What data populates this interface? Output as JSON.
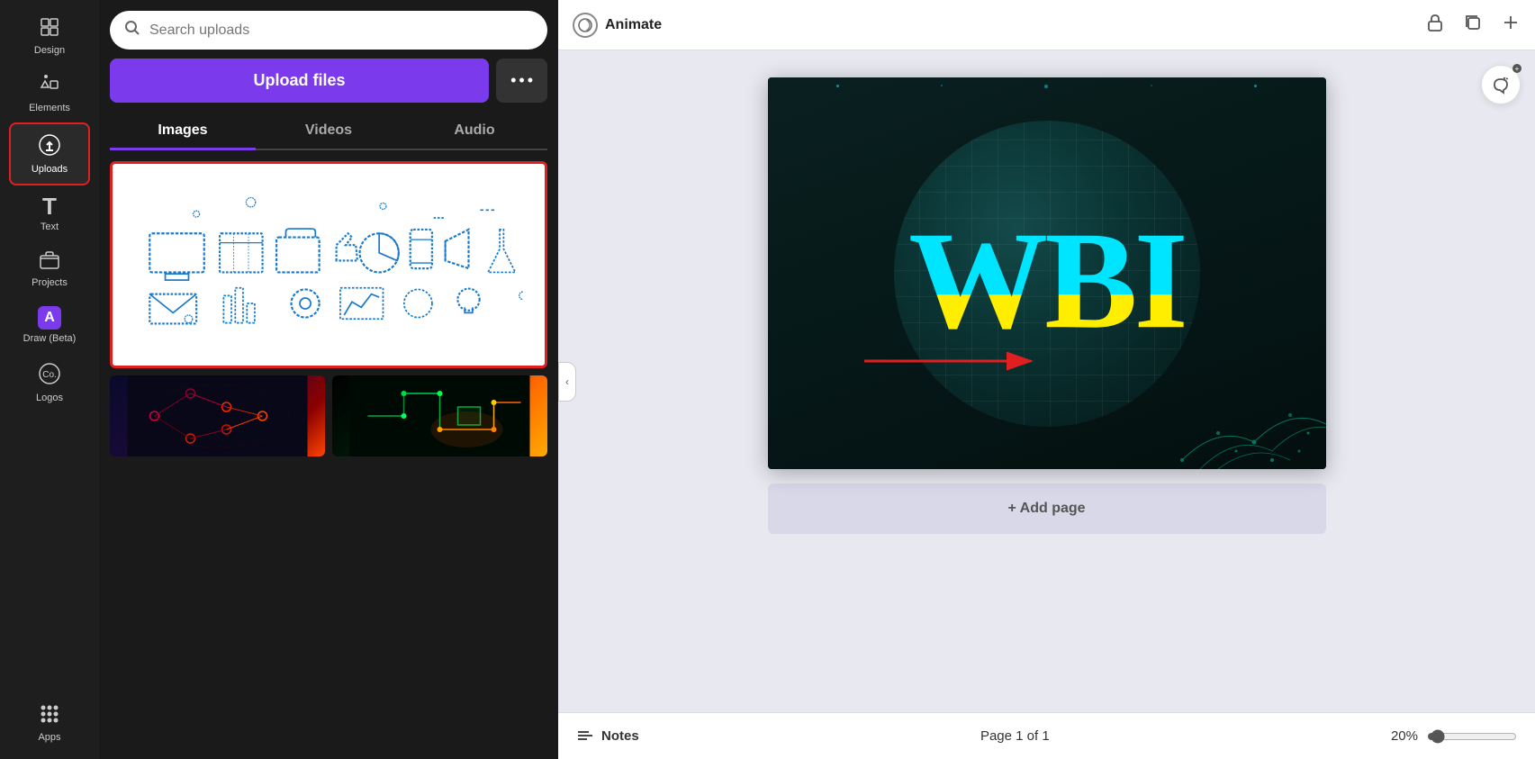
{
  "sidebar": {
    "items": [
      {
        "id": "design",
        "label": "Design",
        "icon": "⊞"
      },
      {
        "id": "elements",
        "label": "Elements",
        "icon": "♡△"
      },
      {
        "id": "uploads",
        "label": "Uploads",
        "icon": "⬆",
        "active": true
      },
      {
        "id": "text",
        "label": "Text",
        "icon": "T"
      },
      {
        "id": "projects",
        "label": "Projects",
        "icon": "⬜"
      },
      {
        "id": "draw",
        "label": "Draw (Beta)",
        "icon": "A"
      },
      {
        "id": "logos",
        "label": "Logos",
        "icon": "©"
      },
      {
        "id": "apps",
        "label": "Apps",
        "icon": "⋮⋮⋮"
      }
    ]
  },
  "upload_panel": {
    "search_placeholder": "Search uploads",
    "upload_label": "Upload files",
    "more_label": "···",
    "tabs": [
      {
        "id": "images",
        "label": "Images",
        "active": true
      },
      {
        "id": "videos",
        "label": "Videos",
        "active": false
      },
      {
        "id": "audio",
        "label": "Audio",
        "active": false
      }
    ]
  },
  "toolbar": {
    "animate_label": "Animate",
    "lock_icon": "🔓",
    "copy_icon": "⧉",
    "add_icon": "➕"
  },
  "canvas": {
    "wbi_text": "WBI",
    "add_page_label": "+ Add page"
  },
  "bottom_bar": {
    "notes_label": "Notes",
    "page_info": "Page 1 of 1",
    "zoom_level": "20%"
  },
  "colors": {
    "upload_btn": "#7c3aed",
    "active_tab_border": "#7c3aed",
    "selected_border": "#e02020",
    "arrow_color": "#e02020",
    "wbi_top": "#00e5ff",
    "wbi_bottom": "#ffee00",
    "sidebar_bg": "#1e1e1e",
    "panel_bg": "#1a1a1a"
  }
}
